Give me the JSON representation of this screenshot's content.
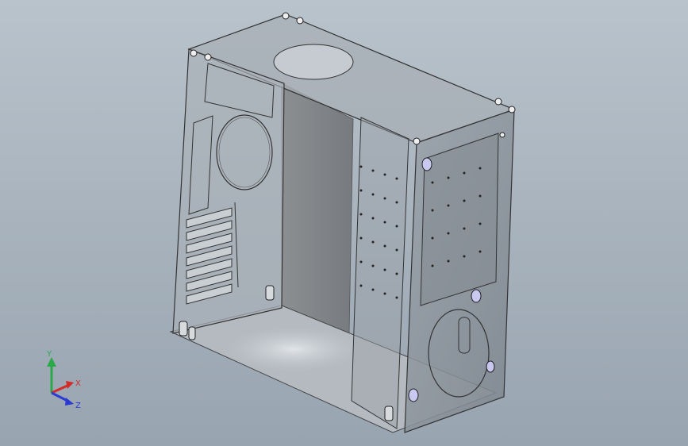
{
  "viewport": {
    "background_top": "#b9c3cc",
    "background_bottom": "#98a4b0",
    "model_name": "pc-case-enclosure"
  },
  "triad": {
    "x_label": "X",
    "y_label": "Y",
    "z_label": "Z",
    "x_color": "#d42a2a",
    "y_color": "#2aa84a",
    "z_color": "#2a3ad4"
  }
}
